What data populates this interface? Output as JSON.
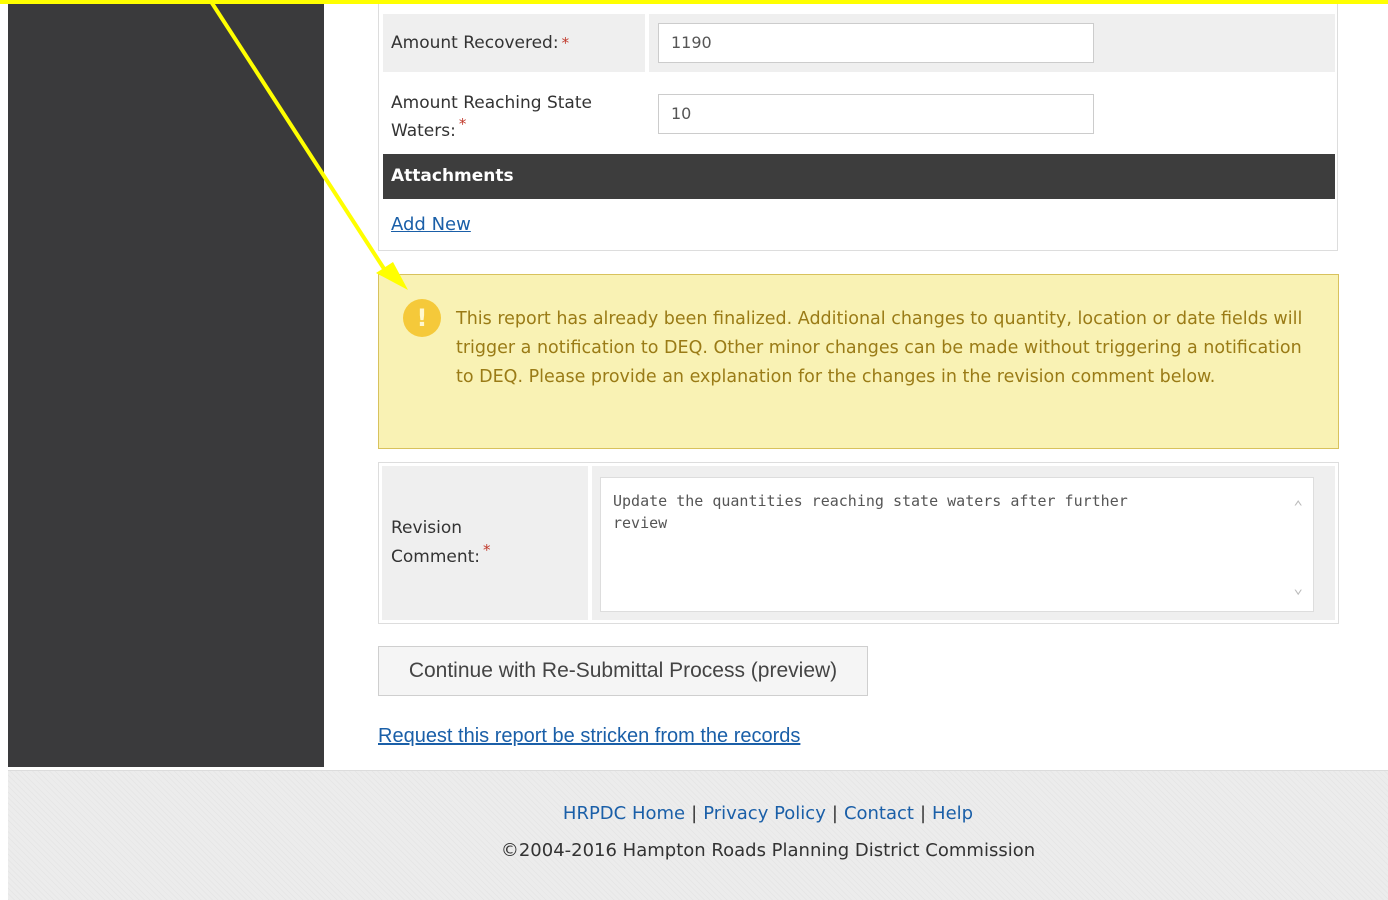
{
  "form": {
    "amount_recovered": {
      "label": "Amount Recovered:",
      "required_mark": "*",
      "value": "1190"
    },
    "amount_reaching": {
      "label_line1": "Amount Reaching State",
      "label_line2": "Waters:",
      "required_mark": "*",
      "value": "10"
    },
    "attachments": {
      "header": "Attachments",
      "add_new_label": "Add New"
    }
  },
  "alert": {
    "icon": "exclamation-icon",
    "icon_glyph": "!",
    "message": "This report has already been finalized. Additional changes to quantity, location or date fields will trigger a notification to DEQ. Other minor changes can be made without triggering a notification to DEQ. Please provide an explanation for the changes in the revision comment below."
  },
  "revision": {
    "label_line1": "Revision",
    "label_line2": "Comment:",
    "required_mark": "*",
    "value": "Update the quantities reaching state waters after further review"
  },
  "actions": {
    "continue_label": "Continue with Re-Submittal Process (preview)",
    "strike_link_label": "Request this report be stricken from the records"
  },
  "footer": {
    "links": [
      "HRPDC Home",
      "Privacy Policy",
      "Contact",
      "Help"
    ],
    "separator": "|",
    "copyright": "©2004-2016 Hampton Roads Planning District Commission"
  },
  "colors": {
    "annotation_arrow": "#ffff00",
    "sidebar": "#3a3a3c",
    "link": "#1a5fa8",
    "alert_background": "#f9f2b4",
    "alert_text": "#9a7b16"
  }
}
